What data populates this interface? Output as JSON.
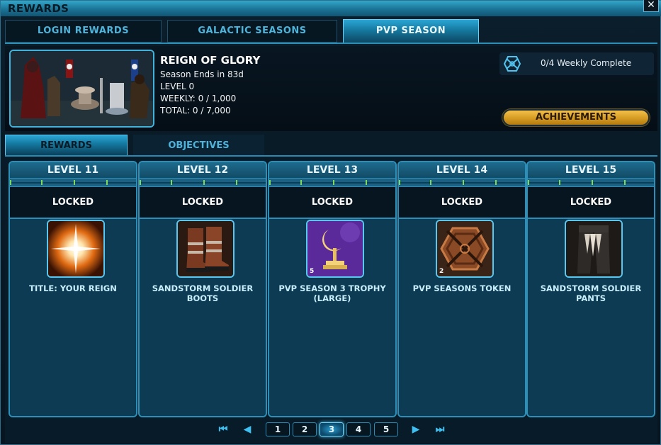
{
  "window": {
    "title": "REWARDS",
    "close_label": "✕"
  },
  "top_tabs": [
    {
      "label": "LOGIN REWARDS",
      "active": false
    },
    {
      "label": "GALACTIC SEASONS",
      "active": false
    },
    {
      "label": "PVP SEASON",
      "active": true
    }
  ],
  "season": {
    "title": "REIGN OF GLORY",
    "ends": "Season Ends in 83d",
    "level": "LEVEL 0",
    "weekly": "WEEKLY: 0 / 1,000",
    "total": "TOTAL: 0 / 7,000",
    "weekly_complete": "0/4 Weekly Complete",
    "weekly_icon": "hexagon-emblem-icon",
    "achievements_label": "ACHIEVEMENTS"
  },
  "sub_tabs": [
    {
      "label": "REWARDS",
      "active": true
    },
    {
      "label": "OBJECTIVES",
      "active": false
    }
  ],
  "columns": [
    {
      "level": "LEVEL 11",
      "status": "LOCKED",
      "reward": "TITLE: YOUR REIGN",
      "icon": "radiant-light-icon",
      "count": ""
    },
    {
      "level": "LEVEL 12",
      "status": "LOCKED",
      "reward": "SANDSTORM SOLDIER BOOTS",
      "icon": "boots-icon",
      "count": ""
    },
    {
      "level": "LEVEL 13",
      "status": "LOCKED",
      "reward": "PVP SEASON 3 TROPHY (LARGE)",
      "icon": "trophy-icon",
      "count": "5"
    },
    {
      "level": "LEVEL 14",
      "status": "LOCKED",
      "reward": "PVP SEASONS TOKEN",
      "icon": "token-icon",
      "count": "2"
    },
    {
      "level": "LEVEL 15",
      "status": "LOCKED",
      "reward": "SANDSTORM SOLDIER PANTS",
      "icon": "pants-icon",
      "count": ""
    }
  ],
  "pager": {
    "first": "⏮",
    "prev": "◀",
    "next": "▶",
    "last": "⏭",
    "pages": [
      "1",
      "2",
      "3",
      "4",
      "5"
    ],
    "current": "3"
  },
  "colors": {
    "accent": "#2b8fb8",
    "gold": "#d59b22",
    "progress_tick": "#7ed957"
  }
}
